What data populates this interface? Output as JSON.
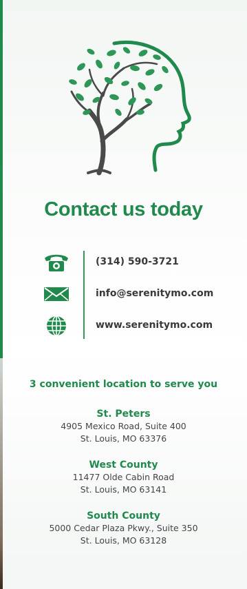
{
  "heading": "Contact us today",
  "contacts": [
    {
      "icon": "phone-icon",
      "text": "(314) 590-3721"
    },
    {
      "icon": "envelope-icon",
      "text": "info@serenitymo.com"
    },
    {
      "icon": "globe-icon",
      "text": "www.serenitymo.com"
    }
  ],
  "tagline": "3 convenient location to serve you",
  "locations": [
    {
      "name": "St. Peters",
      "line1": "4905 Mexico Road, Suite 400",
      "line2": "St. Louis, MO 63376"
    },
    {
      "name": "West County",
      "line1": "11477 Olde Cabin Road",
      "line2": "St. Louis, MO 63141"
    },
    {
      "name": "South County",
      "line1": "5000 Cedar Plaza Pkwy., Suite 350",
      "line2": "St. Louis, MO 63128"
    }
  ],
  "colors": {
    "brand_green": "#1f8a4c",
    "text_gray": "#444444",
    "tree_trunk": "#4a4a4a"
  }
}
